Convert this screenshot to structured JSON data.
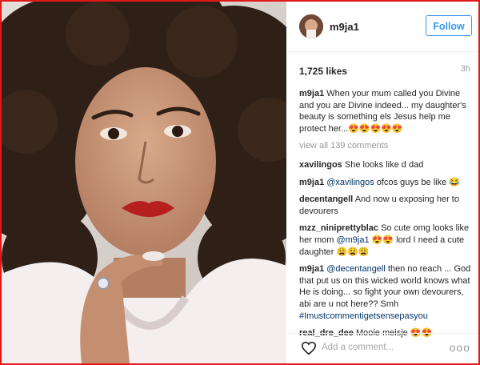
{
  "post": {
    "username": "m9ja1",
    "follow_label": "Follow",
    "likes": "1,725 likes",
    "time": "3h",
    "view_all": "view all 139 comments",
    "add_comment_placeholder": "Add a comment...",
    "more_glyph": "ooo"
  },
  "caption": {
    "user": "m9ja1",
    "text": "When your mum called you Divine and you are Divine indeed... my daughter's beauty is something els Jesus help me protect her...😍😍😍😍😍"
  },
  "comments": [
    {
      "user": "xavilingos",
      "mention": "",
      "text": "She looks like d dad",
      "tag": ""
    },
    {
      "user": "m9ja1",
      "mention": "@xavilingos",
      "text": "ofcos guys be like 😂",
      "tag": ""
    },
    {
      "user": "decentangell",
      "mention": "",
      "text": "And now u exposing her to devourers",
      "tag": ""
    },
    {
      "user": "mzz_niniprettyblac",
      "mention": "@m9ja1",
      "text_before": "So cute omg looks like her mom",
      "text": "😍😍 lord I need a cute daughter 😩😩😩",
      "tag": ""
    },
    {
      "user": "m9ja1",
      "mention": "@decentangell",
      "text": "then no reach ... God that put us on this wicked world knows what He is doing... so fight your own devourers, abi are u not here?? Smh",
      "tag": "#Imustcommentigetsensepasyou"
    },
    {
      "user": "real_dre_dee",
      "mention": "",
      "text": "Mooie meisje 😍😍",
      "tag": ""
    }
  ]
}
